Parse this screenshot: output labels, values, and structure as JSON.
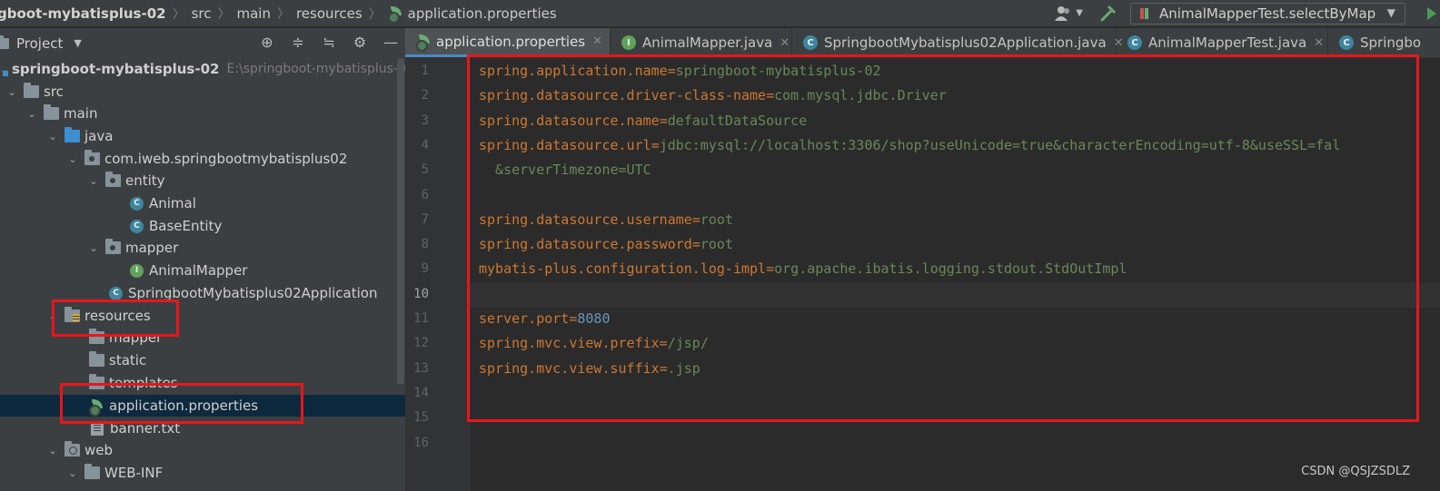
{
  "navbar": {
    "breadcrumbs": [
      "gboot-mybatisplus-02",
      "src",
      "main",
      "resources",
      "application.properties"
    ],
    "run_config": "AnimalMapperTest.selectByMap",
    "icons": [
      "user-icon",
      "hammer-icon",
      "run-icon"
    ]
  },
  "project_panel": {
    "title": "Project",
    "tools": [
      "locate-icon",
      "expand-icon",
      "collapse-icon",
      "gear-icon",
      "minimize-icon"
    ],
    "tree": [
      {
        "label": "springboot-mybatisplus-02",
        "extra": "E:\\springboot-mybatisplus-0",
        "depth": 0,
        "icon": "module-icon",
        "bold": true
      },
      {
        "label": "src",
        "depth": 1,
        "icon": "folder-icon"
      },
      {
        "label": "main",
        "depth": 2,
        "icon": "folder-icon"
      },
      {
        "label": "java",
        "depth": 3,
        "icon": "source-folder-icon"
      },
      {
        "label": "com.iweb.springbootmybatisplus02",
        "depth": 4,
        "icon": "package-icon"
      },
      {
        "label": "entity",
        "depth": 5,
        "icon": "package-icon"
      },
      {
        "label": "Animal",
        "depth": 6,
        "icon": "class-icon"
      },
      {
        "label": "BaseEntity",
        "depth": 6,
        "icon": "class-icon"
      },
      {
        "label": "mapper",
        "depth": 5,
        "icon": "package-icon"
      },
      {
        "label": "AnimalMapper",
        "depth": 6,
        "icon": "interface-icon"
      },
      {
        "label": "SpringbootMybatisplus02Application",
        "depth": 5,
        "icon": "spring-class-icon"
      },
      {
        "label": "resources",
        "depth": 3,
        "icon": "resources-folder-icon"
      },
      {
        "label": "mapper",
        "depth": 4,
        "icon": "folder-icon"
      },
      {
        "label": "static",
        "depth": 4,
        "icon": "folder-icon"
      },
      {
        "label": "templates",
        "depth": 4,
        "icon": "folder-icon"
      },
      {
        "label": "application.properties",
        "depth": 4,
        "icon": "spring-properties-icon",
        "selected": true
      },
      {
        "label": "banner.txt",
        "depth": 4,
        "icon": "text-file-icon"
      },
      {
        "label": "web",
        "depth": 3,
        "icon": "web-folder-icon"
      },
      {
        "label": "WEB-INF",
        "depth": 4,
        "icon": "folder-icon"
      }
    ]
  },
  "tabs": [
    {
      "label": "application.properties",
      "active": true
    },
    {
      "label": "AnimalMapper.java"
    },
    {
      "label": "SpringbootMybatisplus02Application.java"
    },
    {
      "label": "AnimalMapperTest.java"
    },
    {
      "label": "Springbo"
    }
  ],
  "editor": {
    "current_line": 10,
    "lines": [
      {
        "no": "1",
        "key": "spring.application.name",
        "value": "springboot-mybatisplus-02"
      },
      {
        "no": "2",
        "key": "spring.datasource.driver-class-name",
        "value": "com.mysql.jdbc.Driver"
      },
      {
        "no": "3",
        "key": "spring.datasource.name",
        "value": "defaultDataSource"
      },
      {
        "no": "4",
        "key": "spring.datasource.url",
        "value": "jdbc:mysql://localhost:3306/shop?useUnicode=true&characterEncoding=utf-8&useSSL=fal"
      },
      {
        "no": "5",
        "key": "",
        "value": "  &serverTimezone=UTC"
      },
      {
        "no": "6",
        "key": "",
        "value": ""
      },
      {
        "no": "7",
        "key": "spring.datasource.username",
        "value": "root"
      },
      {
        "no": "8",
        "key": "spring.datasource.password",
        "value": "root"
      },
      {
        "no": "9",
        "key": "mybatis-plus.configuration.log-impl",
        "value": "org.apache.ibatis.logging.stdout.StdOutImpl"
      },
      {
        "no": "10",
        "key": "",
        "value": ""
      },
      {
        "no": "11",
        "key": "server.port",
        "value": "8080"
      },
      {
        "no": "12",
        "key": "spring.mvc.view.prefix",
        "value": "/jsp/"
      },
      {
        "no": "13",
        "key": "spring.mvc.view.suffix",
        "value": ".jsp"
      },
      {
        "no": "14",
        "key": "",
        "value": ""
      },
      {
        "no": "15",
        "key": "",
        "value": ""
      },
      {
        "no": "16",
        "key": "",
        "value": ""
      }
    ]
  },
  "watermark": "CSDN @QSJZSDLZ",
  "colors": {
    "annotation_red": "#e8161c",
    "key": "#cc7832",
    "value": "#6a8759",
    "number": "#6897bb",
    "selection": "#0d293e"
  }
}
